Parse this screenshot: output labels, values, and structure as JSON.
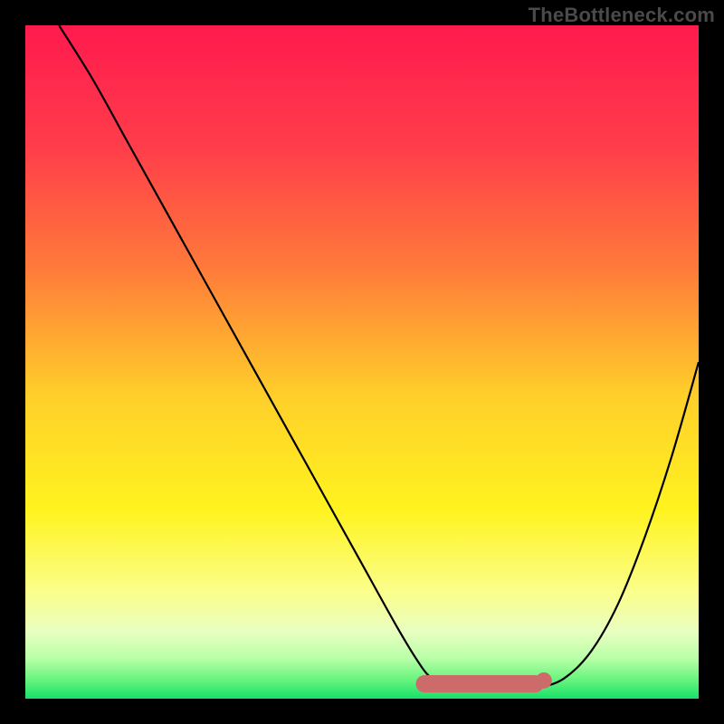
{
  "watermark": "TheBottleneck.com",
  "chart_data": {
    "type": "line",
    "title": "",
    "xlabel": "",
    "ylabel": "",
    "xlim": [
      0,
      100
    ],
    "ylim": [
      0,
      100
    ],
    "background_gradient_stops": [
      {
        "offset": 0.0,
        "color": "#ff1a4e"
      },
      {
        "offset": 0.18,
        "color": "#ff3d4a"
      },
      {
        "offset": 0.36,
        "color": "#ff7a3a"
      },
      {
        "offset": 0.55,
        "color": "#ffcf2a"
      },
      {
        "offset": 0.72,
        "color": "#fff31f"
      },
      {
        "offset": 0.84,
        "color": "#fbfe8a"
      },
      {
        "offset": 0.9,
        "color": "#e9ffc0"
      },
      {
        "offset": 0.94,
        "color": "#b9ffa8"
      },
      {
        "offset": 0.97,
        "color": "#6cf580"
      },
      {
        "offset": 1.0,
        "color": "#18e06a"
      }
    ],
    "series": [
      {
        "name": "curve",
        "stroke": "#000000",
        "stroke_width": 2.2,
        "x": [
          5,
          10,
          15,
          20,
          25,
          30,
          35,
          40,
          45,
          50,
          55,
          58,
          60,
          62,
          65,
          68,
          72,
          76,
          80,
          84,
          88,
          92,
          96,
          100
        ],
        "y": [
          100,
          92,
          83,
          74,
          65,
          56,
          47,
          38,
          29,
          20,
          11,
          6,
          3.3,
          2.2,
          1.6,
          1.3,
          1.3,
          1.6,
          3.0,
          7,
          14,
          24,
          36,
          50
        ]
      }
    ],
    "highlight_band": {
      "name": "optimal-range",
      "color": "#cd6b6a",
      "x_start": 58,
      "x_end": 77,
      "y": 2.2,
      "thickness": 2.6,
      "end_dot_radius": 1.2,
      "end_dot_x": 77,
      "end_dot_y": 2.7
    }
  }
}
